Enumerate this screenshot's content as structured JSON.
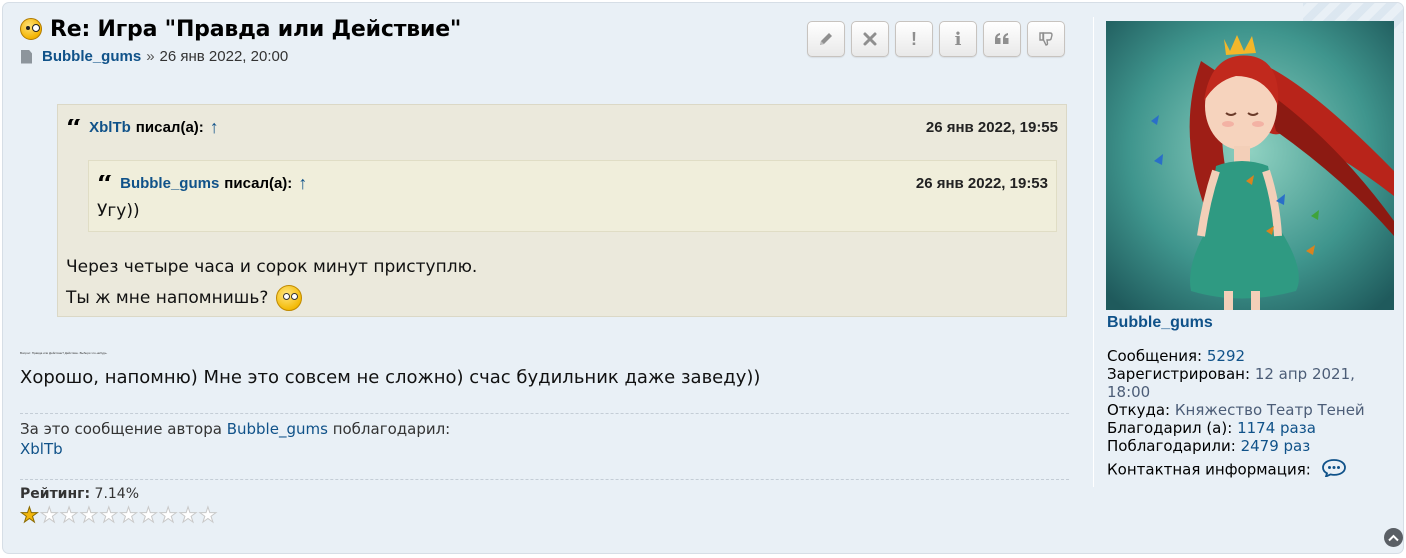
{
  "post": {
    "title": "Re: Игра \"Правда или Действие\"",
    "author": "Bubble_gums",
    "separator": "»",
    "datetime": "26 янв 2022, 20:00"
  },
  "actions": [
    {
      "name": "edit-button",
      "icon": "pencil-icon"
    },
    {
      "name": "delete-button",
      "icon": "close-icon"
    },
    {
      "name": "report-button",
      "icon": "exclamation-icon",
      "label": "!"
    },
    {
      "name": "info-button",
      "icon": "info-icon",
      "label": "i"
    },
    {
      "name": "quote-button",
      "icon": "quote-icon"
    },
    {
      "name": "dislike-button",
      "icon": "thumbs-down-icon"
    }
  ],
  "quote_outer": {
    "user": "XblTb",
    "wrote": "писал(а):",
    "arrow": "↑",
    "date": "26 янв 2022, 19:55",
    "lines": [
      "Через четыре часа и сорок минут приступлю.",
      "Ты ж мне напомнишь?"
    ]
  },
  "quote_inner": {
    "user": "Bubble_gums",
    "wrote": "писал(а):",
    "arrow": "↑",
    "date": "26 янв 2022, 19:53",
    "text": "Угу))"
  },
  "body": {
    "tiny_text": "Вопрос: Правда или Действие? Действие. Выбери что-нибудь.",
    "main_text": "Хорошо, напомню) Мне это совсем не сложно) счас будильник даже заведу))"
  },
  "thanks": {
    "prefix": "За это сообщение автора",
    "author": "Bubble_gums",
    "suffix": "поблагодарил:",
    "users": [
      "XblTb"
    ]
  },
  "rating": {
    "label": "Рейтинг:",
    "value": "7.14%",
    "stars_total": 10,
    "stars_filled": 1
  },
  "profile": {
    "name": "Bubble_gums",
    "fields": [
      {
        "label": "Сообщения:",
        "value": "5292",
        "style": "lnk"
      },
      {
        "label": "Зарегистрирован:",
        "value": "12 апр 2021, 18:00",
        "style": "val"
      },
      {
        "label": "Откуда:",
        "value": "Княжество Театр Теней",
        "style": "val"
      },
      {
        "label": "Благодарил (а):",
        "value": "1174 раза",
        "style": "lnk"
      },
      {
        "label": "Поблагодарили:",
        "value": "2479 раз",
        "style": "lnk"
      }
    ],
    "contact_label": "Контактная информация:"
  },
  "colors": {
    "link": "#105289",
    "panel": "#e9f0f6",
    "quote_bg": "#ebe9dc",
    "star": "#f2b60b"
  }
}
